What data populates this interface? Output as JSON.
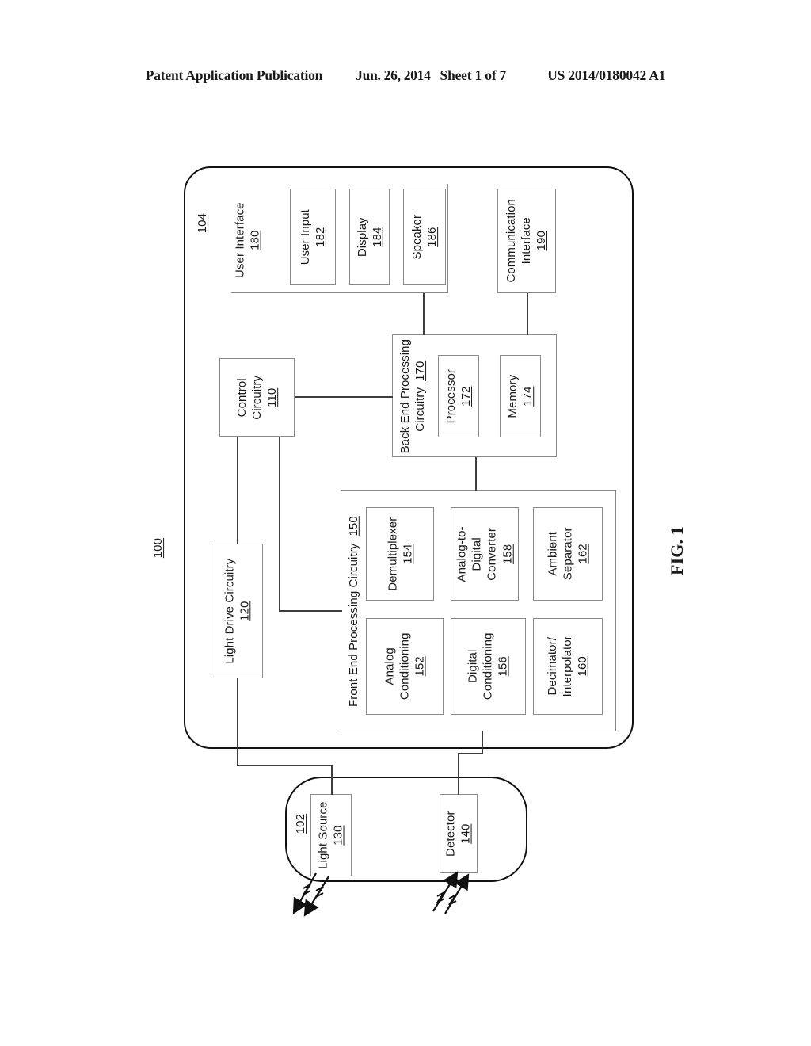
{
  "header": {
    "publication": "Patent Application Publication",
    "date": "Jun. 26, 2014",
    "sheet": "Sheet 1 of 7",
    "docnum": "US 2014/0180042 A1"
  },
  "figure": {
    "label": "FIG. 1",
    "system_ref": "100",
    "monitor_ref": "104",
    "sensor_ref": "102"
  },
  "blocks": {
    "user_interface": {
      "title": "User Interface",
      "ref": "180"
    },
    "user_input": {
      "title": "User Input",
      "ref": "182"
    },
    "display": {
      "title": "Display",
      "ref": "184"
    },
    "speaker": {
      "title": "Speaker",
      "ref": "186"
    },
    "communication_interface": {
      "title_l1": "Communication",
      "title_l2": "Interface",
      "ref": "190"
    },
    "control_circuitry": {
      "title_l1": "Control",
      "title_l2": "Circuitry",
      "ref": "110"
    },
    "back_end": {
      "title_l1": "Back End Processing",
      "title_l2": "Circuitry",
      "ref": "170"
    },
    "processor": {
      "title": "Processor",
      "ref": "172"
    },
    "memory": {
      "title": "Memory",
      "ref": "174"
    },
    "light_drive_circuitry": {
      "title": "Light Drive Circuitry",
      "ref": "120"
    },
    "front_end": {
      "title": "Front End Processing Circuitry",
      "ref": "150"
    },
    "analog_conditioning": {
      "title_l1": "Analog",
      "title_l2": "Conditioning",
      "ref": "152"
    },
    "demultiplexer": {
      "title": "Demultiplexer",
      "ref": "154"
    },
    "digital_conditioning": {
      "title_l1": "Digital",
      "title_l2": "Conditioning",
      "ref": "156"
    },
    "adc": {
      "title_l1": "Analog-to-",
      "title_l2": "Digital",
      "title_l3": "Converter",
      "ref": "158"
    },
    "decimator_interpolator": {
      "title_l1": "Decimator/",
      "title_l2": "Interpolator",
      "ref": "160"
    },
    "ambient_separator": {
      "title_l1": "Ambient",
      "title_l2": "Separator",
      "ref": "162"
    },
    "light_source": {
      "title": "Light Source",
      "ref": "130"
    },
    "detector": {
      "title": "Detector",
      "ref": "140"
    }
  }
}
